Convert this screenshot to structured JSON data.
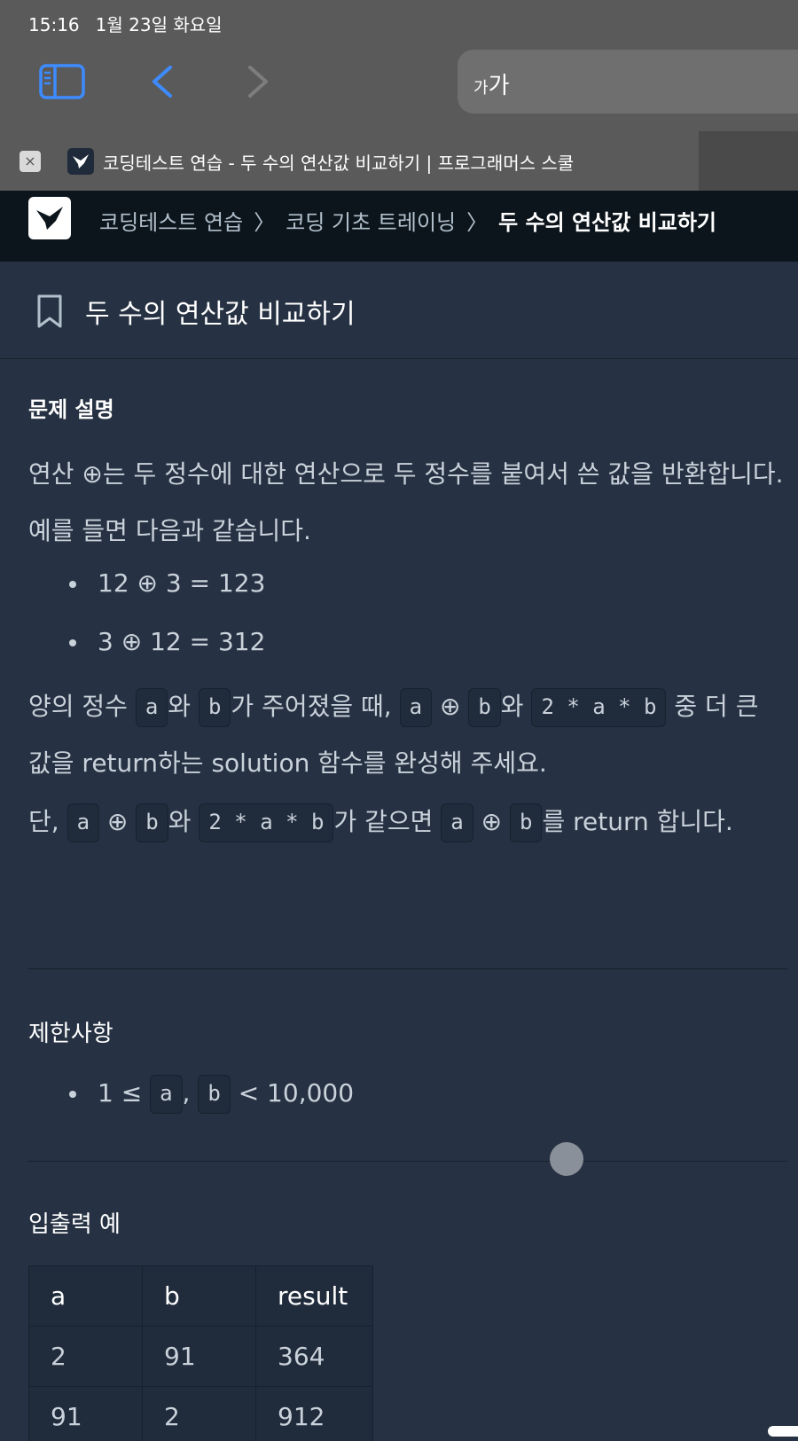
{
  "status_bar": {
    "time": "15:16",
    "date": "1월 23일 화요일"
  },
  "browser": {
    "address_text_small": "가",
    "address_text_large": "가",
    "tab_title": "코딩테스트 연습 - 두 수의 연산값 비교하기 | 프로그래머스 스쿨",
    "tab_close": "×"
  },
  "breadcrumb": {
    "items": [
      "코딩테스트 연습",
      "코딩 기초 트레이닝",
      "두 수의 연산값 비교하기"
    ],
    "separator": "〉"
  },
  "problem": {
    "title": "두 수의 연산값 비교하기",
    "section_description": "문제 설명",
    "intro": "연산 ⊕는 두 정수에 대한 연산으로 두 정수를 붙여서 쓴 값을 반환합니다. 예를 들면 다음과 같습니다.",
    "examples": [
      "12 ⊕ 3 = 123",
      "3 ⊕ 12 = 312"
    ],
    "p2": {
      "t1": "양의 정수 ",
      "a": "a",
      "t2": "와 ",
      "b": "b",
      "t3": "가 주어졌을 때, ",
      "a2": "a",
      "op": " ⊕ ",
      "b2": "b",
      "t4": "와 ",
      "expr": "2 * a * b",
      "t5": " 중 더 큰 값을 return하는 solution 함수를 완성해 주세요."
    },
    "p3": {
      "t1": "단, ",
      "a": "a",
      "op": " ⊕ ",
      "b": "b",
      "t2": "와 ",
      "expr": "2 * a * b",
      "t3": "가 같으면 ",
      "a2": "a",
      "op2": " ⊕ ",
      "b2": "b",
      "t4": "를 return 합니다."
    },
    "section_constraints": "제한사항",
    "constraint": {
      "prefix": "1 ≤ ",
      "a": "a",
      "comma": ", ",
      "b": "b",
      "suffix": " < 10,000"
    },
    "section_io": "입출력 예",
    "io_table": {
      "headers": [
        "a",
        "b",
        "result"
      ],
      "rows": [
        [
          "2",
          "91",
          "364"
        ],
        [
          "91",
          "2",
          "912"
        ]
      ]
    }
  },
  "colors": {
    "page_bg": "#263243",
    "header_bg": "#0c151c",
    "chrome_bg": "#5a5a5a",
    "accent_blue": "#3d8bff"
  }
}
